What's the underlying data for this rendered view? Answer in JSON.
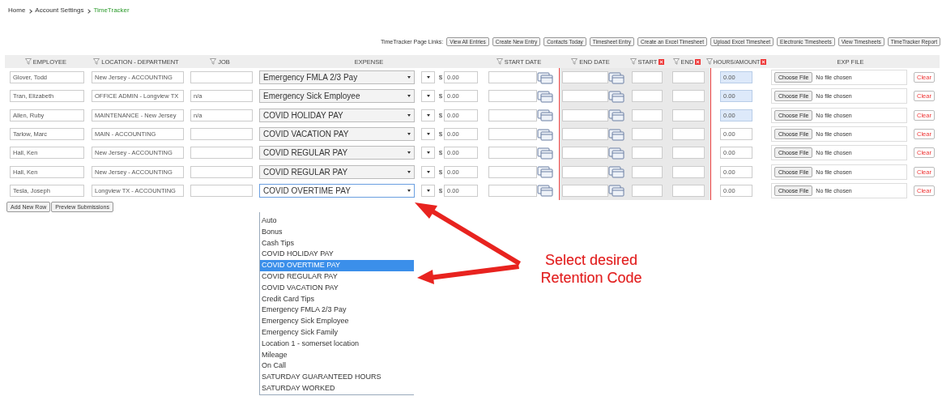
{
  "breadcrumb": [
    {
      "label": "Home",
      "current": false
    },
    {
      "label": "Account Settings",
      "current": false
    },
    {
      "label": "TimeTracker",
      "current": true
    }
  ],
  "page_links": {
    "label": "TimeTracker Page Links:",
    "buttons": [
      "View All Entries",
      "Create New Entry",
      "Contacts Today",
      "Timesheet Entry",
      "Create an Excel Timesheet",
      "Upload Excel Timesheet",
      "Electronic Timesheets",
      "View Timesheets",
      "TimeTracker Report"
    ]
  },
  "table": {
    "columns": [
      {
        "label": "EMPLOYEE",
        "filter": true,
        "removable": false
      },
      {
        "label": "LOCATION - DEPARTMENT",
        "filter": true,
        "removable": false
      },
      {
        "label": "JOB",
        "filter": true,
        "removable": false
      },
      {
        "label": "EXPENSE",
        "filter": false,
        "removable": false
      },
      {
        "label": "START DATE",
        "filter": true,
        "removable": false
      },
      {
        "label": "END DATE",
        "filter": true,
        "removable": false
      },
      {
        "label": "START",
        "filter": true,
        "removable": true
      },
      {
        "label": "END",
        "filter": true,
        "removable": true
      },
      {
        "label": "HOURS/AMOUNT",
        "filter": true,
        "removable": true
      },
      {
        "label": "EXP FILE",
        "filter": false,
        "removable": false
      }
    ],
    "rows": [
      {
        "employee": "Glover, Todd",
        "location": "New Jersey - ACCOUNTING",
        "job": "",
        "expense": "Emergency FMLA 2/3 Pay",
        "unit": "$",
        "amount": "0.00",
        "hours": "0.00",
        "highlighted": true,
        "file_button": "Choose File",
        "file_status": "No file chosen",
        "clear": "Clear"
      },
      {
        "employee": "Tran, Elizabeth",
        "location": "OFFICE ADMIN - Longview TX",
        "job": "n/a",
        "expense": "Emergency Sick Employee",
        "unit": "$",
        "amount": "0.00",
        "hours": "0.00",
        "highlighted": true,
        "file_button": "Choose File",
        "file_status": "No file chosen",
        "clear": "Clear"
      },
      {
        "employee": "Allen, Ruby",
        "location": "MAINTENANCE - New Jersey",
        "job": "n/a",
        "expense": "COVID HOLIDAY PAY",
        "unit": "$",
        "amount": "0.00",
        "hours": "0.00",
        "highlighted": true,
        "file_button": "Choose File",
        "file_status": "No file chosen",
        "clear": "Clear"
      },
      {
        "employee": "Tarlow, Marc",
        "location": "MAIN - ACCOUNTING",
        "job": "",
        "expense": "COVID VACATION PAY",
        "unit": "$",
        "amount": "0.00",
        "hours": "0.00",
        "highlighted": false,
        "file_button": "Choose File",
        "file_status": "No file chosen",
        "clear": "Clear"
      },
      {
        "employee": "Hall, Ken",
        "location": "New Jersey - ACCOUNTING",
        "job": "",
        "expense": "COVID REGULAR PAY",
        "unit": "$",
        "amount": "0.00",
        "hours": "0.00",
        "highlighted": false,
        "file_button": "Choose File",
        "file_status": "No file chosen",
        "clear": "Clear"
      },
      {
        "employee": "Hall, Ken",
        "location": "New Jersey - ACCOUNTING",
        "job": "",
        "expense": "COVID REGULAR PAY",
        "unit": "$",
        "amount": "0.00",
        "hours": "0.00",
        "highlighted": false,
        "file_button": "Choose File",
        "file_status": "No file chosen",
        "clear": "Clear"
      },
      {
        "employee": "Tesla, Joseph",
        "location": "Longview TX - ACCOUNTING",
        "job": "",
        "expense": "COVID OVERTIME PAY",
        "unit": "$",
        "amount": "0.00",
        "hours": "0.00",
        "highlighted": false,
        "file_button": "Choose File",
        "file_status": "No file chosen",
        "clear": "Clear"
      }
    ]
  },
  "actions": [
    "Add New Row",
    "Preview Submissions"
  ],
  "dropdown": {
    "options": [
      {
        "label": "Auto",
        "selected": false
      },
      {
        "label": "Bonus",
        "selected": false
      },
      {
        "label": "Cash Tips",
        "selected": false
      },
      {
        "label": "COVID HOLIDAY PAY",
        "selected": false
      },
      {
        "label": "COVID OVERTIME PAY",
        "selected": true
      },
      {
        "label": "COVID REGULAR PAY",
        "selected": false
      },
      {
        "label": "COVID VACATION PAY",
        "selected": false
      },
      {
        "label": "Credit Card Tips",
        "selected": false
      },
      {
        "label": "Emergency FMLA 2/3 Pay",
        "selected": false
      },
      {
        "label": "Emergency Sick Employee",
        "selected": false
      },
      {
        "label": "Emergency Sick Family",
        "selected": false
      },
      {
        "label": "Location 1 - somerset location",
        "selected": false
      },
      {
        "label": "Mileage",
        "selected": false
      },
      {
        "label": "On Call",
        "selected": false
      },
      {
        "label": "SATURDAY GUARANTEED HOURS",
        "selected": false
      },
      {
        "label": "SATURDAY WORKED",
        "selected": false
      }
    ]
  },
  "callout": {
    "text": "Select desired Retention Code"
  }
}
